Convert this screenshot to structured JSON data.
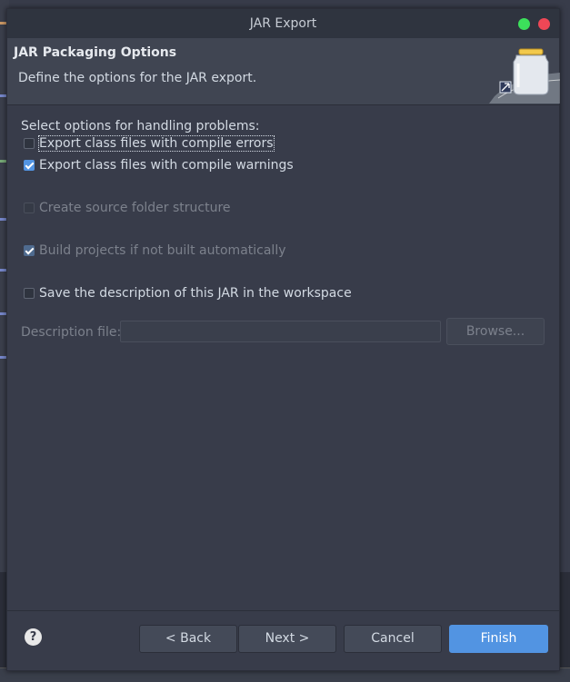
{
  "window": {
    "title": "JAR Export"
  },
  "header": {
    "title": "JAR Packaging Options",
    "description": "Define the options for the JAR export."
  },
  "options": {
    "section_label": "Select options for handling problems:",
    "export_errors": {
      "label": "Export class files with compile errors",
      "checked": false
    },
    "export_warnings": {
      "label": "Export class files with compile warnings",
      "checked": true
    },
    "source_folder": {
      "label": "Create source folder structure",
      "checked": false,
      "enabled": false
    },
    "build_projects": {
      "label": "Build projects if not built automatically",
      "checked": true,
      "enabled": false
    },
    "save_description": {
      "label": "Save the description of this JAR in the workspace",
      "checked": false
    }
  },
  "description_file": {
    "label": "Description file:",
    "value": "",
    "browse_label": "Browse..."
  },
  "footer": {
    "help": "?",
    "back_label": "< Back",
    "next_label": "Next >",
    "cancel_label": "Cancel",
    "finish_label": "Finish"
  },
  "colors": {
    "accent": "#5294e2",
    "dialog_bg": "#383c4a",
    "header_bg": "#404552",
    "close_dot": "#ee4756",
    "maximize_dot": "#3ce05b"
  }
}
